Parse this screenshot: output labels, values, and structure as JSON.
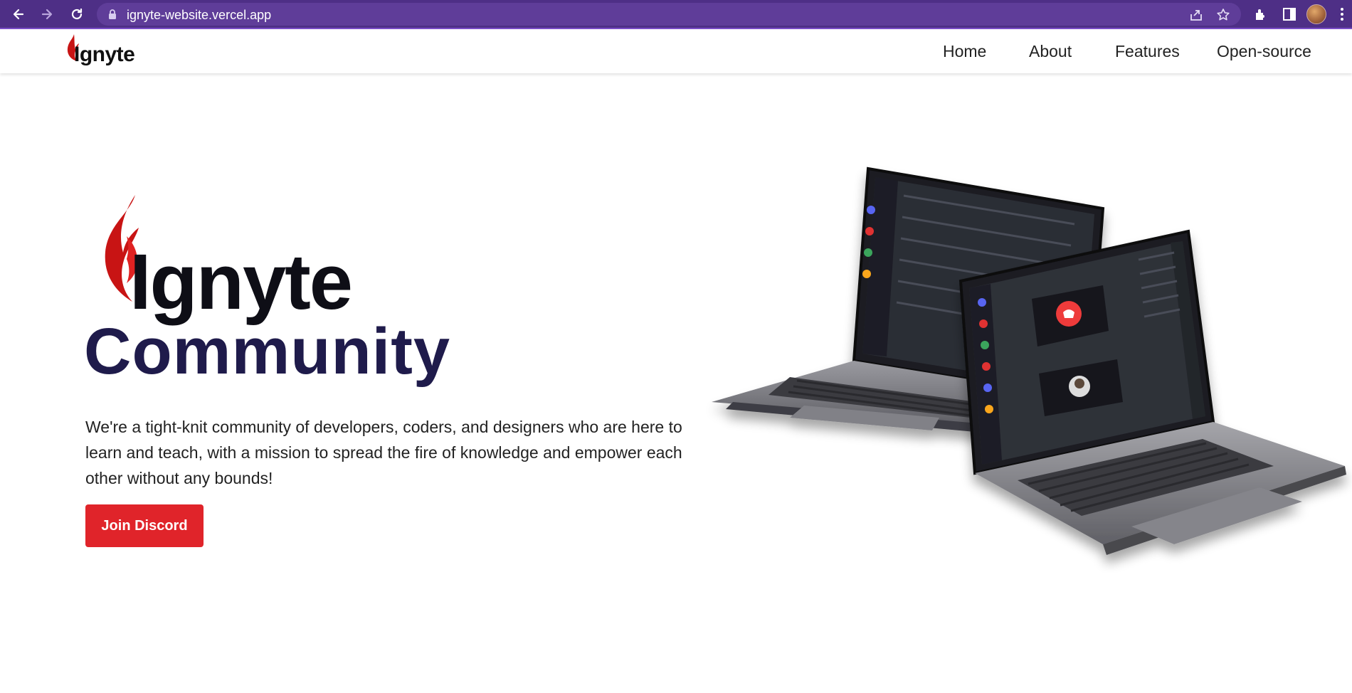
{
  "browser": {
    "url": "ignyte-website.vercel.app",
    "icons": [
      "back-icon",
      "forward-icon",
      "reload-icon",
      "lock-icon",
      "share-icon",
      "bookmark-star-icon",
      "extensions-icon",
      "side-panel-icon",
      "profile-avatar",
      "menu-kebab-icon"
    ]
  },
  "header": {
    "logo_text": "Ignyte",
    "nav": [
      "Home",
      "About",
      "Features",
      "Open-source"
    ]
  },
  "hero": {
    "logo_text": "Ignyte",
    "title": "Community",
    "description": "We're a tight-knit community of developers, coders, and designers who are here to learn and teach, with a mission to spread the fire of knowledge and empower each other without any bounds!",
    "cta_label": "Join Discord"
  },
  "colors": {
    "chrome": "#4e2f86",
    "flame": "#c81414",
    "title": "#1f1b4b",
    "cta": "#e0242a"
  }
}
